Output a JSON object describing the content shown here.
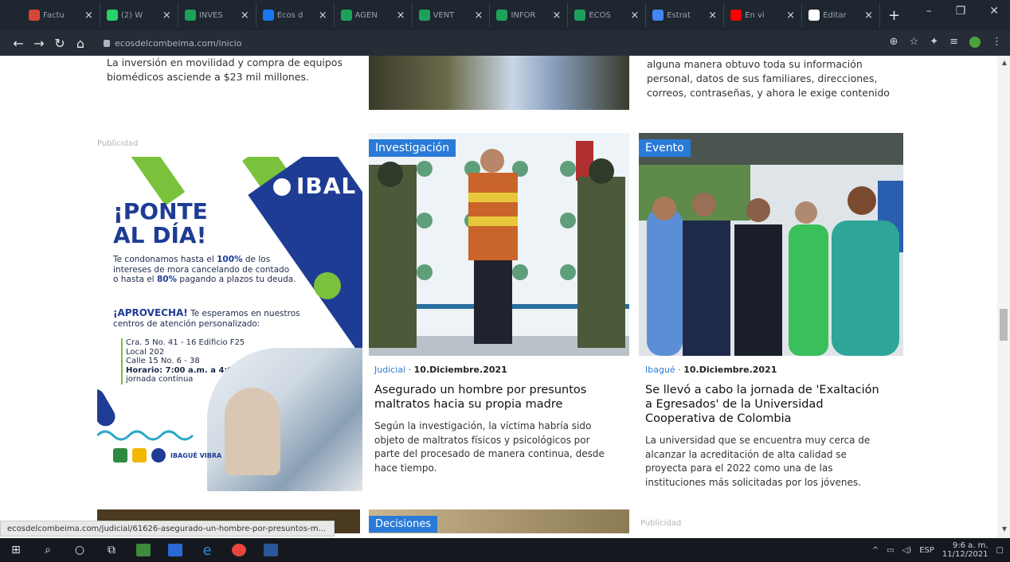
{
  "browser": {
    "tabs": [
      {
        "label": "Factu",
        "color": "#d44638"
      },
      {
        "label": "(2) W",
        "color": "#25d366"
      },
      {
        "label": "INVES",
        "color": "#1da15a"
      },
      {
        "label": "Ecos d",
        "color": "#1877f2"
      },
      {
        "label": "AGEN",
        "color": "#1da15a"
      },
      {
        "label": "VENT",
        "color": "#1da15a"
      },
      {
        "label": "INFOR",
        "color": "#1da15a"
      },
      {
        "label": "ECOS",
        "color": "#1da15a"
      },
      {
        "label": "Estrat",
        "color": "#4285f4"
      },
      {
        "label": "En vi",
        "color": "#ff0000"
      },
      {
        "label": "Editar",
        "color": "#ffffff"
      }
    ],
    "url": "ecosdelcombeima.com/inicio"
  },
  "top_snippets": {
    "left": "La inversión en movilidad y compra de equipos biomédicos asciende a $23 mil millones.",
    "right": "alguna manera obtuvo toda su información personal, datos de sus familiares, direcciones, correos, contraseñas, y ahora le exige contenido"
  },
  "ad": {
    "label": "Publicidad",
    "logo": "IBAL",
    "headline_1": "¡PONTE",
    "headline_2": "AL DÍA!",
    "body_pre": "Te condonamos hasta el ",
    "body_pct1": "100%",
    "body_mid": " de los intereses de mora cancelando de contado o hasta el ",
    "body_pct2": "80%",
    "body_post": " pagando a plazos tu deuda.",
    "aprovecha": "¡APROVECHA!",
    "aprovecha_text": " Te esperamos en nuestros centros de atención personalizado:",
    "addr1": "Cra. 5 No. 41 - 16  Edificio F25",
    "addr2": "Local 202",
    "addr3": "Calle 15 No. 6 - 38",
    "horario": "Horario: 7:00 a.m. a 4:00 p.m.",
    "jornada": "jornada continua",
    "footer_tag": "IBAGUÉ VIBRA"
  },
  "cards": [
    {
      "badge": "Investigación",
      "category": "Judicial",
      "date": "10.Diciembre.2021",
      "title": "Asegurado un hombre por presuntos maltratos hacia su propia madre",
      "excerpt": "Según la investigación, la víctima habría sido objeto de maltratos físicos y psicológicos por parte del procesado de manera continua, desde hace tiempo."
    },
    {
      "badge": "Evento",
      "category": "Ibagué",
      "date": "10.Diciembre.2021",
      "title": "Se llevó a cabo la jornada de 'Exaltación a Egresados' de la Universidad Cooperativa de Colombia",
      "excerpt": "La universidad que se encuentra muy cerca de alcanzar la acreditación de alta calidad se proyecta para el 2022 como una de las instituciones más solicitadas por los jóvenes."
    }
  ],
  "bottom": {
    "badge": "Decisiones",
    "pub": "Publicidad"
  },
  "status_url": "ecosdelcombeima.com/judicial/61626-asegurado-un-hombre-por-presuntos-m...",
  "taskbar": {
    "lang": "ESP",
    "time": "9:6 a. m.",
    "date": "11/12/2021"
  }
}
